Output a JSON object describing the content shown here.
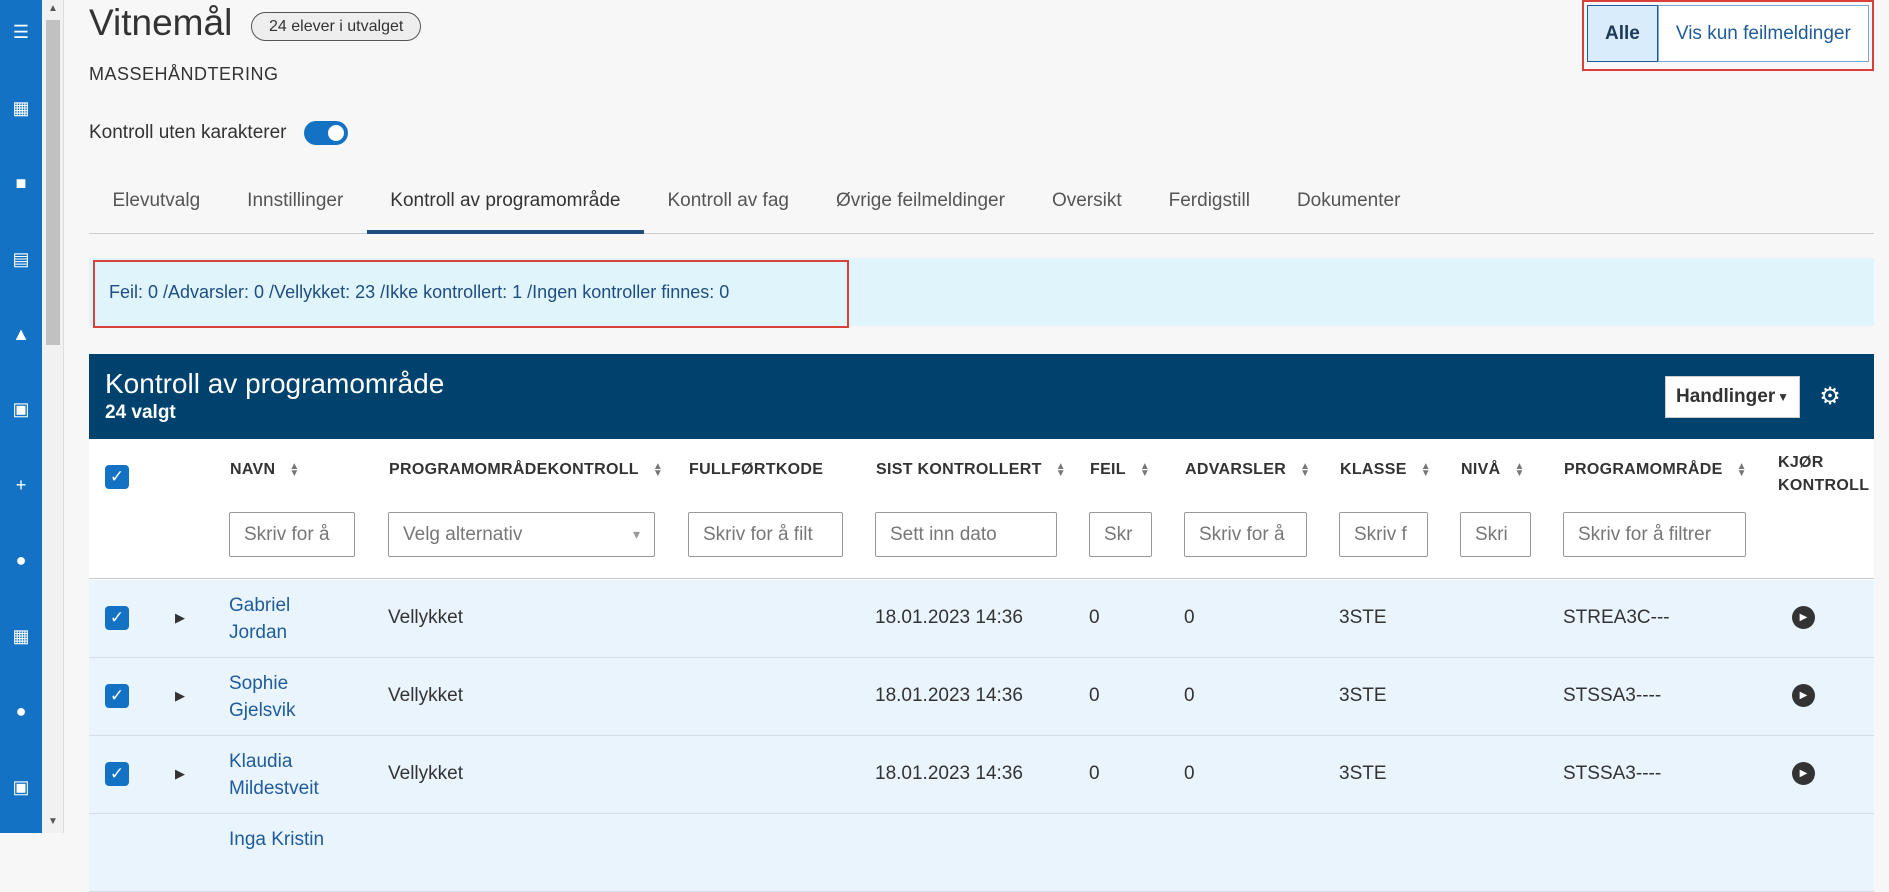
{
  "sidebar": {
    "icons": [
      "menu-icon",
      "apps-grid-icon",
      "book-icon",
      "teacher-icon",
      "graduate-icon",
      "briefcase-icon",
      "plus-icon",
      "chat-icon",
      "calendar-icon",
      "people-icon",
      "calendar-check-icon"
    ]
  },
  "page": {
    "title": "Vitnemål",
    "badge": "24 elever i utvalget",
    "subtitle": "MASSEHÅNDTERING"
  },
  "filter_toggle": {
    "all": "Alle",
    "errors_only": "Vis kun feilmeldinger"
  },
  "control_toggle": {
    "label": "Kontroll uten karakterer",
    "on": true
  },
  "tabs": [
    "Elevutvalg",
    "Innstillinger",
    "Kontroll av programområde",
    "Kontroll av fag",
    "Øvrige feilmeldinger",
    "Oversikt",
    "Ferdigstill",
    "Dokumenter"
  ],
  "summary": "Feil: 0 /Advarsler: 0 /Vellykket: 23 /Ikke kontrollert: 1 /Ingen kontroller finnes: 0",
  "panel": {
    "title": "Kontroll av programområde",
    "count": "24 valgt",
    "actions": "Handlinger"
  },
  "columns": {
    "name": "NAVN",
    "program_control": "PROGRAMOMRÅDEKONTROLL",
    "completion": "FULLFØRTKODE",
    "last_checked": "SIST KONTROLLERT",
    "errors": "FEIL",
    "warnings": "ADVARSLER",
    "class": "KLASSE",
    "level": "NIVÅ",
    "program": "PROGRAMOMRÅDE",
    "run_line1": "KJØR",
    "run_line2": "KONTROLL"
  },
  "filters": {
    "name": "Skriv for å",
    "program_control": "Velg alternativ",
    "completion": "Skriv for å filt",
    "last_checked": "Sett inn dato",
    "errors": "Skr",
    "warnings": "Skriv for å",
    "class": "Skriv f",
    "level": "Skri",
    "program": "Skriv for å filtrer"
  },
  "rows": [
    {
      "first": "Gabriel",
      "last": "Jordan",
      "status": "Vellykket",
      "completion": "",
      "date": "18.01.2023 14:36",
      "errors": "0",
      "warnings": "0",
      "class": "3STE",
      "level": "",
      "program": "STREA3C---"
    },
    {
      "first": "Sophie",
      "last": "Gjelsvik",
      "status": "Vellykket",
      "completion": "",
      "date": "18.01.2023 14:36",
      "errors": "0",
      "warnings": "0",
      "class": "3STE",
      "level": "",
      "program": "STSSA3----"
    },
    {
      "first": "Klaudia",
      "last": "Mildestveit",
      "status": "Vellykket",
      "completion": "",
      "date": "18.01.2023 14:36",
      "errors": "0",
      "warnings": "0",
      "class": "3STE",
      "level": "",
      "program": "STSSA3----"
    },
    {
      "first": "Inga Kristin",
      "last": "",
      "status": "",
      "completion": "",
      "date": "",
      "errors": "",
      "warnings": "",
      "class": "",
      "level": "",
      "program": ""
    }
  ]
}
